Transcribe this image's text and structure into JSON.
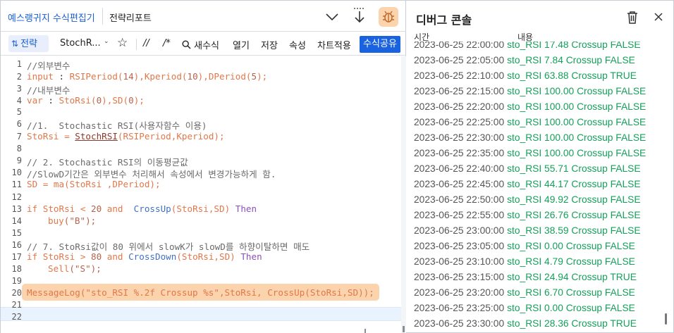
{
  "editor": {
    "app_title": "예스랭귀지 수식편집기",
    "tab_title": "전략리포트",
    "toolbar": {
      "strategy_icon": "⇅",
      "strategy_label": "전략",
      "strategy_name": "StochR...",
      "caret": "⌄",
      "star": "☆",
      "comment_button": "//",
      "block_comment_button": "/*",
      "new_formula_icon": "search-icon",
      "new_formula": "새수식",
      "open": "열기",
      "save": "저장",
      "properties": "속성",
      "apply_chart": "차트적용",
      "share_formula": "수식공유"
    },
    "line_numbers": [
      "1",
      "2",
      "3",
      "4",
      "5",
      "6",
      "7",
      "8",
      "9",
      "10",
      "11",
      "12",
      "13",
      "14",
      "15",
      "16",
      "17",
      "18",
      "19",
      "20",
      "21",
      "22"
    ]
  },
  "console": {
    "title": "디버그 콘솔",
    "col_time": "시간",
    "col_content": "내용",
    "logs": [
      {
        "time": "2023-06-25 22:00:00",
        "msg": "sto_RSI 17.48 Crossup FALSE"
      },
      {
        "time": "2023-06-25 22:05:00",
        "msg": "sto_RSI 7.84 Crossup FALSE"
      },
      {
        "time": "2023-06-25 22:10:00",
        "msg": "sto_RSI 63.88 Crossup TRUE"
      },
      {
        "time": "2023-06-25 22:15:00",
        "msg": "sto_RSI 100.00 Crossup FALSE"
      },
      {
        "time": "2023-06-25 22:20:00",
        "msg": "sto_RSI 100.00 Crossup FALSE"
      },
      {
        "time": "2023-06-25 22:25:00",
        "msg": "sto_RSI 100.00 Crossup FALSE"
      },
      {
        "time": "2023-06-25 22:30:00",
        "msg": "sto_RSI 100.00 Crossup FALSE"
      },
      {
        "time": "2023-06-25 22:35:00",
        "msg": "sto_RSI 100.00 Crossup FALSE"
      },
      {
        "time": "2023-06-25 22:40:00",
        "msg": "sto_RSI 55.71 Crossup FALSE"
      },
      {
        "time": "2023-06-25 22:45:00",
        "msg": "sto_RSI 44.17 Crossup FALSE"
      },
      {
        "time": "2023-06-25 22:50:00",
        "msg": "sto_RSI 49.92 Crossup FALSE"
      },
      {
        "time": "2023-06-25 22:55:00",
        "msg": "sto_RSI 26.76 Crossup FALSE"
      },
      {
        "time": "2023-06-25 23:00:00",
        "msg": "sto_RSI 38.59 Crossup FALSE"
      },
      {
        "time": "2023-06-25 23:05:00",
        "msg": "sto_RSI 0.00 Crossup FALSE"
      },
      {
        "time": "2023-06-25 23:10:00",
        "msg": "sto_RSI 4.79 Crossup FALSE"
      },
      {
        "time": "2023-06-25 23:15:00",
        "msg": "sto_RSI 24.94 Crossup TRUE"
      },
      {
        "time": "2023-06-25 23:20:00",
        "msg": "sto_RSI 6.70 Crossup FALSE"
      },
      {
        "time": "2023-06-25 23:25:00",
        "msg": "sto_RSI 0.00 Crossup FALSE"
      },
      {
        "time": "2023-06-25 23:30:00",
        "msg": "sto_RSI 28.36 Crossup TRUE"
      }
    ]
  },
  "code": {
    "l1": "//외부변수",
    "l2_kw": "input",
    "l2_rest": " : ",
    "l2_a": "RSIPeriod(",
    "l2_a_num": "14",
    "l2_b": "),Kperiod(",
    "l2_b_num": "10",
    "l2_c": "),DPeriod(",
    "l2_c_num": "5",
    "l2_d": ");",
    "l3": "//내부변수",
    "l4_kw": "var",
    "l4_rest": " : ",
    "l4_a": "StoRsi(",
    "l4_a_num": "0",
    "l4_b": "),SD(",
    "l4_b_num": "0",
    "l4_c": ");",
    "l6": "//1.  Stochastic RSI(사용자함수 이용)",
    "l7_a": "StoRsi = ",
    "l7_fn": "StochRSI",
    "l7_b": "(RSIPeriod,Kperiod);",
    "l9": "// 2. Stochastic RSI의 이동평균값",
    "l10": "//SlowD기간은 외부변수 처리해서 속성에서 변경가능하게 함.",
    "l11_a": "SD = ",
    "l11_fn": "ma",
    "l11_b": "(StoRsi ,DPeriod);",
    "l13_if": "if",
    "l13_a": " StoRsi < ",
    "l13_num": "20",
    "l13_and": " and ",
    "l13_fn": " CrossUp",
    "l13_b": "(StoRsi,SD) ",
    "l13_then": "Then",
    "l14_fn": "buy",
    "l14_str": "(\"B\");",
    "l16": "// 7. StoRsi값이 80 위에서 slowK가 slowD를 하향이탈하면 매도",
    "l17_if": "if",
    "l17_a": " StoRsi > ",
    "l17_num": "80",
    "l17_and": " and ",
    "l17_fn": "CrossDown",
    "l17_b": "(StoRsi,SD) ",
    "l17_then": "Then",
    "l18_fn": "Sell",
    "l18_str": "(\"S\");",
    "l20": "MessageLog(\"sto_RSI %.2f Crossup %s\",StoRsi, CrossUp(StoRsi,SD));"
  },
  "colors": {
    "accent": "#1a63e0",
    "highlight": "#fbd3ad",
    "log_message": "#14a05a"
  }
}
